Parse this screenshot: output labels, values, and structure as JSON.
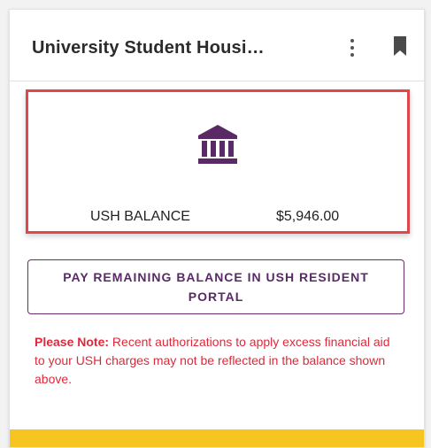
{
  "card": {
    "title": "University Student Housi…",
    "balance": {
      "label": "USH BALANCE",
      "amount": "$5,946.00"
    },
    "pay_button_label": "PAY REMAINING BALANCE IN USH RESIDENT PORTAL",
    "note": {
      "prefix": "Please Note:",
      "text": " Recent authorizations to apply excess financial aid to your USH charges may not be reflected in the balance shown above."
    }
  },
  "icons": {
    "menu": "kebab-menu-icon",
    "bookmark": "bookmark-icon",
    "bank": "bank-icon"
  },
  "colors": {
    "accent_purple": "#5a2a67",
    "highlight_red": "#e0474c",
    "note_red": "#e0283a",
    "footer_yellow": "#f7c51f"
  }
}
